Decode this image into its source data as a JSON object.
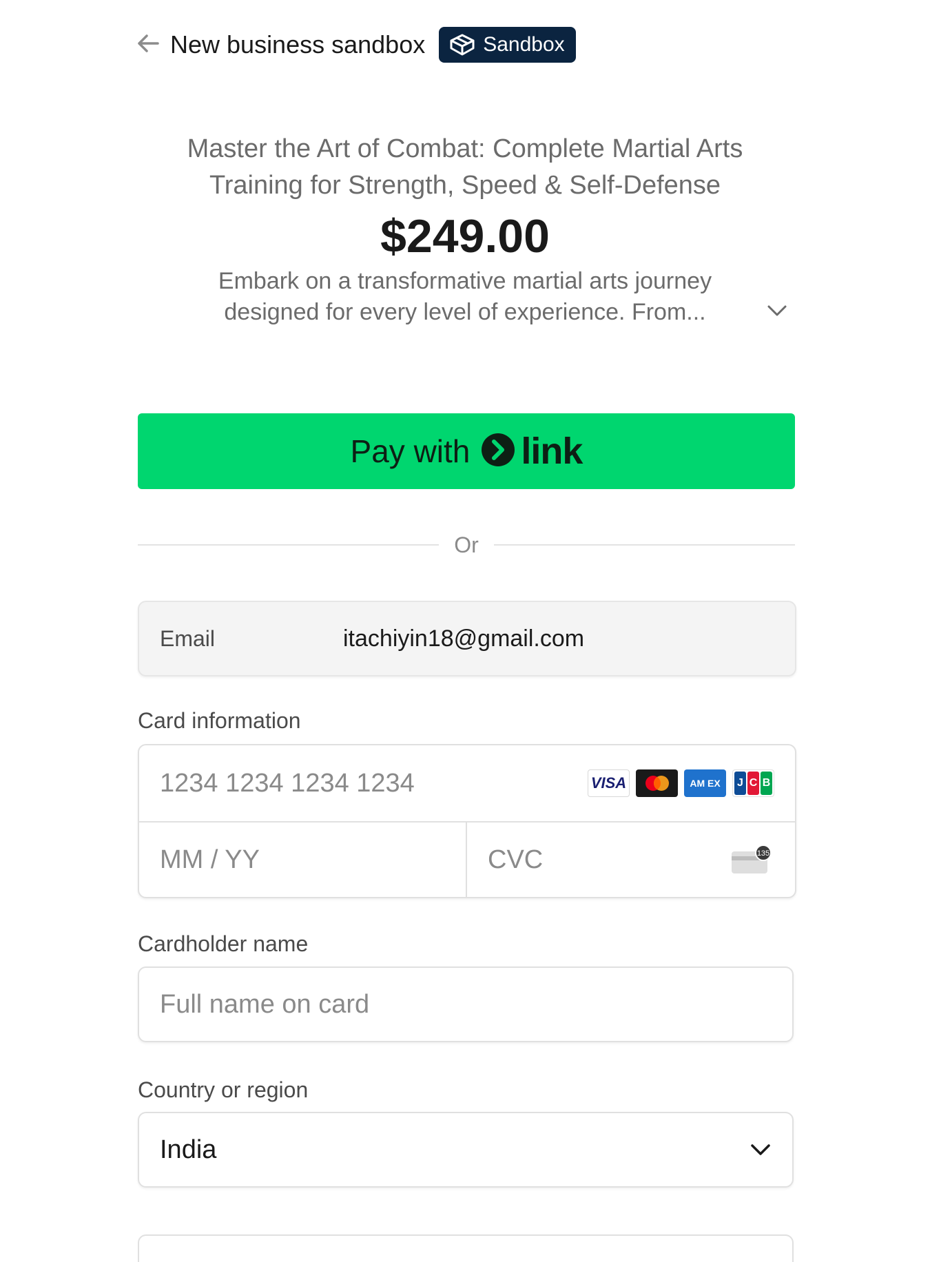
{
  "header": {
    "business_name": "New business sandbox",
    "badge_label": "Sandbox",
    "back_icon": "arrow-left-icon",
    "badge_icon": "cube-icon"
  },
  "product": {
    "title": "Master the Art of Combat: Complete Martial Arts Training for Strength, Speed & Self-Defense",
    "price": "$249.00",
    "description": "Embark on a transformative martial arts journey designed for every level of experience. From...",
    "expand_icon": "chevron-down-icon"
  },
  "link_button": {
    "label": "Pay with",
    "brand": "link",
    "color": "#00d66f"
  },
  "divider": {
    "label": "Or"
  },
  "email": {
    "label": "Email",
    "value": "itachiyin18@gmail.com"
  },
  "card": {
    "label": "Card information",
    "number_placeholder": "1234 1234 1234 1234",
    "expiry_placeholder": "MM / YY",
    "cvc_placeholder": "CVC",
    "cvc_hint": "135",
    "brands": [
      "VISA",
      "Mastercard",
      "AMEX",
      "JCB"
    ],
    "amex_text": "AM EX",
    "jcb_letters": [
      "J",
      "C",
      "B"
    ]
  },
  "cardholder": {
    "label": "Cardholder name",
    "placeholder": "Full name on card"
  },
  "country": {
    "label": "Country or region",
    "value": "India",
    "icon": "chevron-down-icon"
  }
}
